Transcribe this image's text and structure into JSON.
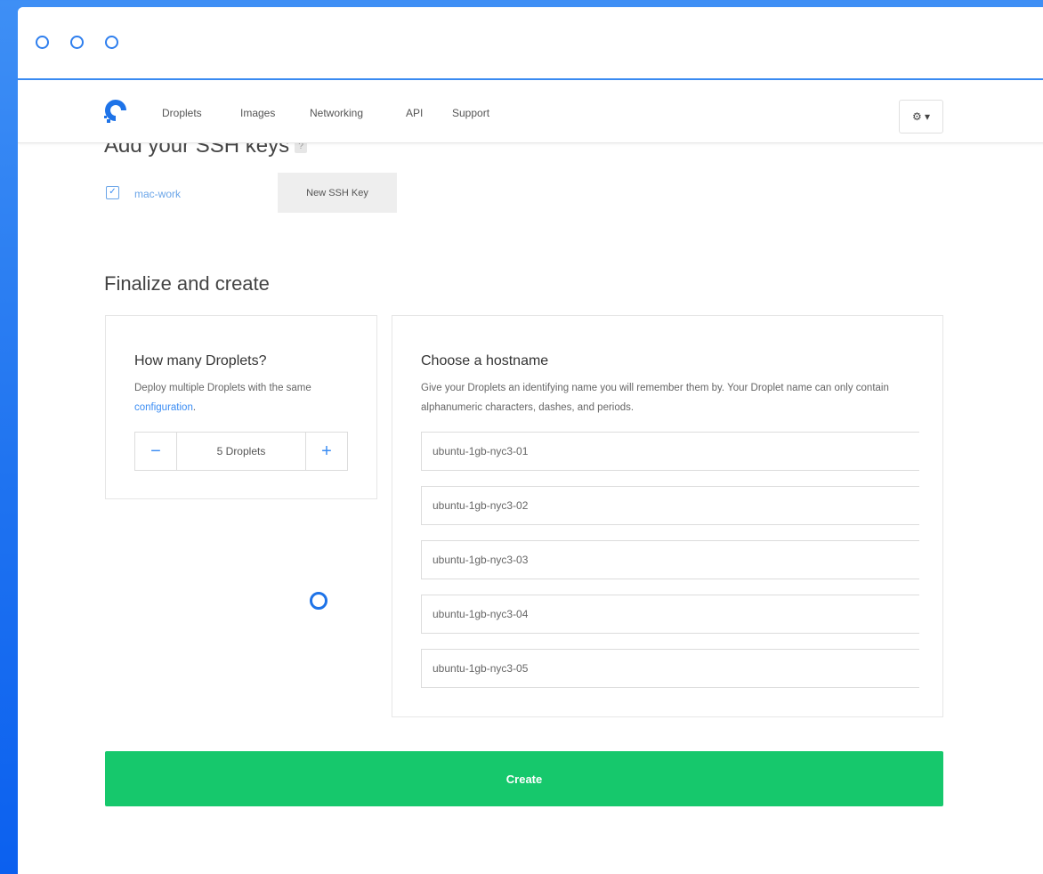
{
  "navbar": {
    "items": [
      "Droplets",
      "Images",
      "Networking",
      "API",
      "Support"
    ],
    "settings_label": "⚙ ▾"
  },
  "ssh": {
    "heading": "Add your SSH keys",
    "help": "?",
    "key_label": "mac-work",
    "new_key_button": "New SSH Key"
  },
  "finalize": {
    "heading": "Finalize and create",
    "count_panel": {
      "title": "How many Droplets?",
      "desc_prefix": "Deploy multiple Droplets with the same ",
      "desc_link": "configuration",
      "desc_suffix": ".",
      "minus": "−",
      "plus": "+",
      "value": "5 Droplets"
    },
    "hostname_panel": {
      "title": "Choose a hostname",
      "desc": "Give your Droplets an identifying name you will remember them by. Your Droplet name can only contain alphanumeric characters, dashes, and periods.",
      "hostnames": [
        "ubuntu-1gb-nyc3-01",
        "ubuntu-1gb-nyc3-02",
        "ubuntu-1gb-nyc3-03",
        "ubuntu-1gb-nyc3-04",
        "ubuntu-1gb-nyc3-05"
      ]
    },
    "create_button": "Create"
  },
  "colors": {
    "accent": "#3a8cf3",
    "create": "#16c86c",
    "background": "#1f73f0"
  }
}
